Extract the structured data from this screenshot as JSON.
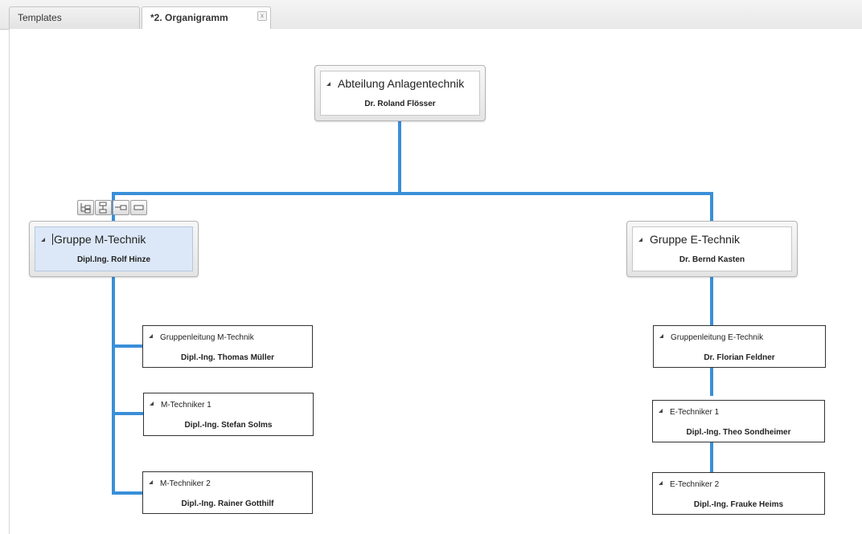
{
  "tabs": [
    {
      "label": "Templates"
    },
    {
      "label": "*2. Organigramm",
      "close": "x"
    }
  ],
  "colors": {
    "connector": "#3a8fd9",
    "selected_fill": "#dce8f7"
  },
  "toolbar_icons": [
    "add-child-icon",
    "add-assistant-icon",
    "add-sibling-icon",
    "delete-node-icon"
  ],
  "orgchart": {
    "root": {
      "title": "Abteilung Anlagentechnik",
      "person": "Dr. Roland Flösser"
    },
    "groups": [
      {
        "title": "Gruppe M-Technik",
        "person": "Dipl.Ing. Rolf Hinze",
        "selected": true
      },
      {
        "title": "Gruppe E-Technik",
        "person": "Dr. Bernd Kasten",
        "selected": false
      }
    ],
    "m_children": [
      {
        "title": "Gruppenleitung M-Technik",
        "person": "Dipl.-Ing. Thomas Müller"
      },
      {
        "title": "M-Techniker 1",
        "person": "Dipl.-Ing. Stefan Solms"
      },
      {
        "title": "M-Techniker 2",
        "person": "Dipl.-Ing. Rainer Gotthilf"
      }
    ],
    "e_children": [
      {
        "title": "Gruppenleitung E-Technik",
        "person": "Dr. Florian Feldner"
      },
      {
        "title": "E-Techniker 1",
        "person": "Dipl.-Ing. Theo Sondheimer"
      },
      {
        "title": "E-Techniker 2",
        "person": "Dipl.-Ing. Frauke Heims"
      }
    ]
  }
}
